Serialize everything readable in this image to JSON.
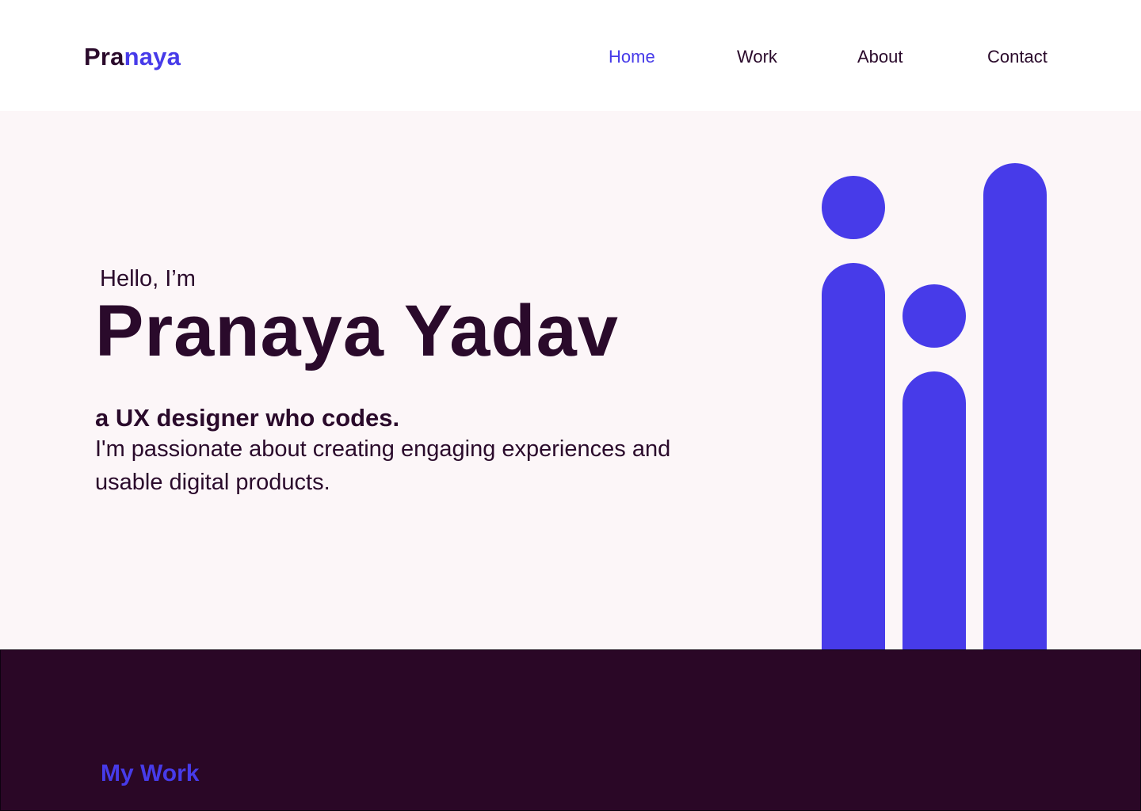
{
  "header": {
    "logo": {
      "part1": "Pra",
      "part2": "naya"
    },
    "nav": [
      {
        "label": "Home",
        "active": true
      },
      {
        "label": "Work",
        "active": false
      },
      {
        "label": "About",
        "active": false
      },
      {
        "label": "Contact",
        "active": false
      }
    ]
  },
  "hero": {
    "greeting": "Hello, I’m",
    "name": "Pranaya Yadav",
    "tagline": "a UX designer who codes.",
    "description": "I'm passionate about creating engaging experiences and usable digital products."
  },
  "work": {
    "title": "My Work"
  },
  "colors": {
    "accent": "#473be9",
    "text": "#2a0a2b",
    "hero_bg": "#fcf6f8",
    "work_bg": "#2a0726"
  }
}
